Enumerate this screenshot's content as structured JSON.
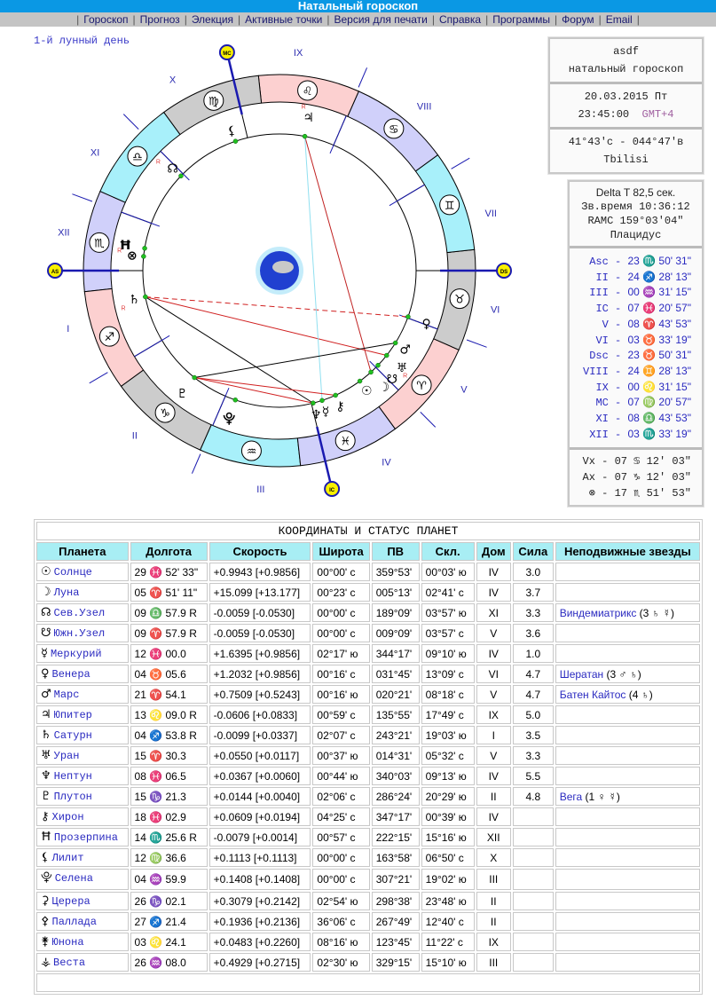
{
  "header": {
    "title": "Натальный гороскоп"
  },
  "menu": [
    "Гороскоп",
    "Прогноз",
    "Элекция",
    "Активные точки",
    "Версия для печати",
    "Справка",
    "Программы",
    "Форум",
    "Email"
  ],
  "lunar_day": "1-й лунный день",
  "info": {
    "name": "asdf",
    "type": "натальный гороскоп",
    "date": "20.03.2015 Пт",
    "time": "23:45:00",
    "tz": "GMT+4",
    "coords": "41°43'с - 044°47'в",
    "city": "Tbilisi"
  },
  "astro": {
    "delta_t": "Delta T  82,5 сек.",
    "sidereal": "Зв.время 10:36:12",
    "ramc": "RAMC 159°03'04\"",
    "system": "Плацидус"
  },
  "cusps": [
    {
      "n": "Asc",
      "v": "23 ♏ 50' 31\""
    },
    {
      "n": "II",
      "v": "24 ♐ 28' 13\""
    },
    {
      "n": "III",
      "v": "00 ♒ 31' 15\""
    },
    {
      "n": "IC",
      "v": "07 ♓ 20' 57\""
    },
    {
      "n": "V",
      "v": "08 ♈ 43' 53\""
    },
    {
      "n": "VI",
      "v": "03 ♉ 33' 19\""
    },
    {
      "n": "Dsc",
      "v": "23 ♉ 50' 31\""
    },
    {
      "n": "VIII",
      "v": "24 ♊ 28' 13\""
    },
    {
      "n": "IX",
      "v": "00 ♌ 31' 15\""
    },
    {
      "n": "MC",
      "v": "07 ♍ 20' 57\""
    },
    {
      "n": "XI",
      "v": "08 ♎ 43' 53\""
    },
    {
      "n": "XII",
      "v": "03 ♏ 33' 19\""
    }
  ],
  "extras": [
    {
      "n": "Vx",
      "v": "07 ♋ 12' 03\""
    },
    {
      "n": "Ax",
      "v": "07 ♑ 12' 03\""
    },
    {
      "n": "⊗",
      "v": "17 ♏ 51' 53\""
    }
  ],
  "chart": {
    "asc": 233.84,
    "house_cusps": [
      233.84,
      264.47,
      300.52,
      337.35,
      8.73,
      33.56,
      53.84,
      84.47,
      120.52,
      157.35,
      188.73,
      213.56
    ],
    "house_labels": [
      "I",
      "II",
      "III",
      "IV",
      "V",
      "VI",
      "VII",
      "VIII",
      "IX",
      "X",
      "XI",
      "XII"
    ],
    "angle_labels": {
      "asc": "AS",
      "dsc": "DS",
      "mc": "MC",
      "ic": "IC"
    },
    "signs": [
      "♈",
      "♉",
      "♊",
      "♋",
      "♌",
      "♍",
      "♎",
      "♏",
      "♐",
      "♑",
      "♒",
      "♓"
    ],
    "sign_colors": {
      "fire": "#fcd0d0",
      "earth": "#cccccc",
      "air": "#a8f0fa",
      "water": "#d0d0fa"
    },
    "bodies": [
      {
        "id": "sun",
        "g": "☉",
        "lon": 359.87
      },
      {
        "id": "moon",
        "g": "☽",
        "lon": 5.85
      },
      {
        "id": "north-node",
        "g": "☊",
        "lon": 189.97,
        "r": true
      },
      {
        "id": "south-node",
        "g": "☋",
        "lon": 9.97,
        "r": true
      },
      {
        "id": "mercury",
        "g": "☿",
        "lon": 342.0
      },
      {
        "id": "venus",
        "g": "♀",
        "lon": 34.09
      },
      {
        "id": "mars",
        "g": "♂",
        "lon": 21.9
      },
      {
        "id": "jupiter",
        "g": "♃",
        "lon": 133.15,
        "r": true
      },
      {
        "id": "saturn",
        "g": "♄",
        "lon": 244.9,
        "r": true
      },
      {
        "id": "uranus",
        "g": "♅",
        "lon": 15.5
      },
      {
        "id": "neptune",
        "g": "♆",
        "lon": 338.1
      },
      {
        "id": "pluto",
        "g": "♇",
        "lon": 285.35
      },
      {
        "id": "chiron",
        "g": "⚷",
        "lon": 348.05
      },
      {
        "id": "proserpina",
        "g": "Ħ",
        "lon": 224.43,
        "r": true
      },
      {
        "id": "lilith",
        "g": "⚸",
        "lon": 162.61
      },
      {
        "id": "selena",
        "g": "⯓",
        "lon": 305.0
      },
      {
        "id": "part-of-fortune",
        "g": "⊗",
        "lon": 227.86
      }
    ],
    "aspects": [
      {
        "a": "saturn",
        "b": "venus",
        "c": "#d02020",
        "dash": true
      },
      {
        "a": "saturn",
        "b": "uranus",
        "c": "#d02020"
      },
      {
        "a": "saturn",
        "b": "neptune",
        "c": "#000000"
      },
      {
        "a": "jupiter",
        "b": "moon",
        "c": "#c02020"
      },
      {
        "a": "jupiter",
        "b": "mercury",
        "c": "#90e0f0"
      },
      {
        "a": "pluto",
        "b": "mars",
        "c": "#000000"
      },
      {
        "a": "pluto",
        "b": "neptune",
        "c": "#d02020"
      },
      {
        "a": "pluto",
        "b": "chiron",
        "c": "#d02020"
      }
    ]
  },
  "table": {
    "title": "КООРДИНАТЫ И СТАТУС ПЛАНЕТ",
    "headers": [
      "Планета",
      "Долгота",
      "Скорость",
      "Широта",
      "ПВ",
      "Скл.",
      "Дом",
      "Сила",
      "Неподвижные звезды"
    ],
    "rows": [
      {
        "g": "☉",
        "name": "Солнце",
        "lon": "29 ♓ 52' 33\"",
        "speed": "+0.9943  [+0.9856]",
        "lat": "00°00' с",
        "pv": "359°53'",
        "decl": "00°03' ю",
        "house": "IV",
        "power": "3.0",
        "stars": ""
      },
      {
        "g": "☽",
        "name": "Луна",
        "lon": "05 ♈ 51' 11\"",
        "speed": "+15.099  [+13.177]",
        "lat": "00°23' с",
        "pv": "005°13'",
        "decl": "02°41' с",
        "house": "IV",
        "power": "3.7",
        "stars": ""
      },
      {
        "g": "☊",
        "name": "Сев.Узел",
        "lon": "09 ♎ 57.9  R",
        "speed": "-0.0059  [-0.0530]",
        "lat": "00°00' с",
        "pv": "189°09'",
        "decl": "03°57' ю",
        "house": "XI",
        "power": "3.3",
        "stars": "Виндемиатрикс",
        "stars_note": " (3 ♄ ☿)"
      },
      {
        "g": "☋",
        "name": "Южн.Узел",
        "lon": "09 ♈ 57.9  R",
        "speed": "-0.0059  [-0.0530]",
        "lat": "00°00' с",
        "pv": "009°09'",
        "decl": "03°57' с",
        "house": "V",
        "power": "3.6",
        "stars": ""
      },
      {
        "g": "☿",
        "name": "Меркурий",
        "lon": "12 ♓ 00.0",
        "speed": "+1.6395  [+0.9856]",
        "lat": "02°17' ю",
        "pv": "344°17'",
        "decl": "09°10' ю",
        "house": "IV",
        "power": "1.0",
        "stars": ""
      },
      {
        "g": "♀",
        "name": "Венера",
        "lon": "04 ♉ 05.6",
        "speed": "+1.2032  [+0.9856]",
        "lat": "00°16' с",
        "pv": "031°45'",
        "decl": "13°09' с",
        "house": "VI",
        "power": "4.7",
        "stars": "Шератан",
        "stars_note": " (3 ♂ ♄)"
      },
      {
        "g": "♂",
        "name": "Марс",
        "lon": "21 ♈ 54.1",
        "speed": "+0.7509  [+0.5243]",
        "lat": "00°16' ю",
        "pv": "020°21'",
        "decl": "08°18' с",
        "house": "V",
        "power": "4.7",
        "stars": "Батен Кайтос",
        "stars_note": " (4 ♄)"
      },
      {
        "g": "♃",
        "name": "Юпитер",
        "lon": "13 ♌ 09.0  R",
        "speed": "-0.0606  [+0.0833]",
        "lat": "00°59' с",
        "pv": "135°55'",
        "decl": "17°49' с",
        "house": "IX",
        "power": "5.0",
        "stars": ""
      },
      {
        "g": "♄",
        "name": "Сатурн",
        "lon": "04 ♐ 53.8  R",
        "speed": "-0.0099  [+0.0337]",
        "lat": "02°07' с",
        "pv": "243°21'",
        "decl": "19°03' ю",
        "house": "I",
        "power": "3.5",
        "stars": ""
      },
      {
        "g": "♅",
        "name": "Уран",
        "lon": "15 ♈ 30.3",
        "speed": "+0.0550  [+0.0117]",
        "lat": "00°37' ю",
        "pv": "014°31'",
        "decl": "05°32' с",
        "house": "V",
        "power": "3.3",
        "stars": ""
      },
      {
        "g": "♆",
        "name": "Нептун",
        "lon": "08 ♓ 06.5",
        "speed": "+0.0367  [+0.0060]",
        "lat": "00°44' ю",
        "pv": "340°03'",
        "decl": "09°13' ю",
        "house": "IV",
        "power": "5.5",
        "stars": ""
      },
      {
        "g": "♇",
        "name": "Плутон",
        "lon": "15 ♑ 21.3",
        "speed": "+0.0144  [+0.0040]",
        "lat": "02°06' с",
        "pv": "286°24'",
        "decl": "20°29' ю",
        "house": "II",
        "power": "4.8",
        "stars": "Вега",
        "stars_note": " (1 ♀ ☿)"
      },
      {
        "g": "⚷",
        "name": "Хирон",
        "lon": "18 ♓ 02.9",
        "speed": "+0.0609  [+0.0194]",
        "lat": "04°25' с",
        "pv": "347°17'",
        "decl": "00°39' ю",
        "house": "IV",
        "power": "",
        "stars": ""
      },
      {
        "g": "Ħ",
        "name": "Прозерпина",
        "lon": "14 ♏ 25.6  R",
        "speed": "-0.0079  [+0.0014]",
        "lat": "00°57' с",
        "pv": "222°15'",
        "decl": "15°16' ю",
        "house": "XII",
        "power": "",
        "stars": ""
      },
      {
        "g": "⚸",
        "name": "Лилит",
        "lon": "12 ♍ 36.6",
        "speed": "+0.1113  [+0.1113]",
        "lat": "00°00' с",
        "pv": "163°58'",
        "decl": "06°50' с",
        "house": "X",
        "power": "",
        "stars": ""
      },
      {
        "g": "⯓",
        "name": "Селена",
        "lon": "04 ♒ 59.9",
        "speed": "+0.1408  [+0.1408]",
        "lat": "00°00' с",
        "pv": "307°21'",
        "decl": "19°02' ю",
        "house": "III",
        "power": "",
        "stars": ""
      },
      {
        "g": "⚳",
        "name": "Церера",
        "lon": "26 ♑ 02.1",
        "speed": "+0.3079  [+0.2142]",
        "lat": "02°54' ю",
        "pv": "298°38'",
        "decl": "23°48' ю",
        "house": "II",
        "power": "",
        "stars": ""
      },
      {
        "g": "⚴",
        "name": "Паллада",
        "lon": "27 ♐ 21.4",
        "speed": "+0.1936  [+0.2136]",
        "lat": "36°06' с",
        "pv": "267°49'",
        "decl": "12°40' с",
        "house": "II",
        "power": "",
        "stars": ""
      },
      {
        "g": "⚵",
        "name": "Юнона",
        "lon": "03 ♌ 24.1",
        "speed": "+0.0483  [+0.2260]",
        "lat": "08°16' ю",
        "pv": "123°45'",
        "decl": "11°22' с",
        "house": "IX",
        "power": "",
        "stars": ""
      },
      {
        "g": "⚶",
        "name": "Веста",
        "lon": "26 ♒ 08.0",
        "speed": "+0.4929  [+0.2715]",
        "lat": "02°30' ю",
        "pv": "329°15'",
        "decl": "15°10' ю",
        "house": "III",
        "power": "",
        "stars": ""
      }
    ]
  }
}
